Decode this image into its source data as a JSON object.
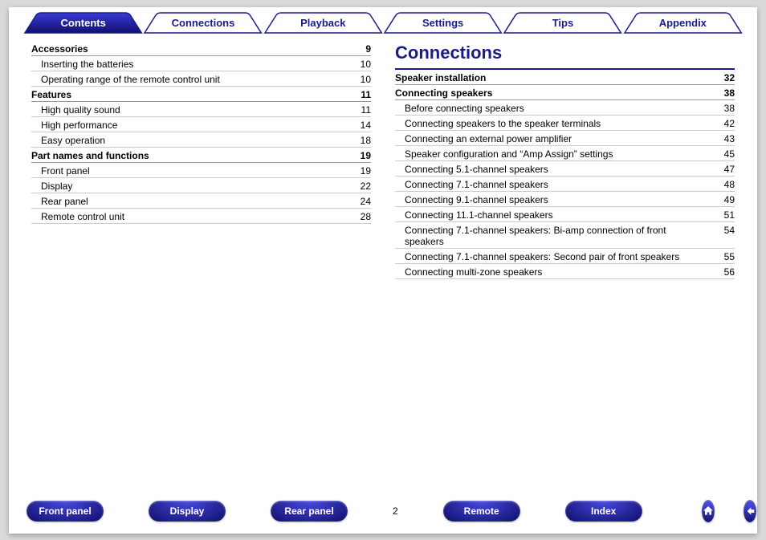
{
  "tabs": [
    {
      "label": "Contents",
      "active": true
    },
    {
      "label": "Connections",
      "active": false
    },
    {
      "label": "Playback",
      "active": false
    },
    {
      "label": "Settings",
      "active": false
    },
    {
      "label": "Tips",
      "active": false
    },
    {
      "label": "Appendix",
      "active": false
    }
  ],
  "left_col": [
    {
      "type": "hdr",
      "label": "Accessories",
      "page": "9"
    },
    {
      "type": "item",
      "label": "Inserting the batteries",
      "page": "10"
    },
    {
      "type": "item",
      "label": "Operating range of the remote control unit",
      "page": "10"
    },
    {
      "type": "hdr",
      "label": "Features",
      "page": "11"
    },
    {
      "type": "item",
      "label": "High quality sound",
      "page": "11"
    },
    {
      "type": "item",
      "label": "High performance",
      "page": "14"
    },
    {
      "type": "item",
      "label": "Easy operation",
      "page": "18"
    },
    {
      "type": "hdr",
      "label": "Part names and functions",
      "page": "19"
    },
    {
      "type": "item",
      "label": "Front panel",
      "page": "19"
    },
    {
      "type": "item",
      "label": "Display",
      "page": "22"
    },
    {
      "type": "item",
      "label": "Rear panel",
      "page": "24"
    },
    {
      "type": "item",
      "label": "Remote control unit",
      "page": "28"
    }
  ],
  "right_title": "Connections",
  "right_col": [
    {
      "type": "hdr",
      "label": "Speaker installation",
      "page": "32",
      "bluetop": true
    },
    {
      "type": "hdr",
      "label": "Connecting speakers",
      "page": "38"
    },
    {
      "type": "item",
      "label": "Before connecting speakers",
      "page": "38"
    },
    {
      "type": "item",
      "label": "Connecting speakers to the speaker terminals",
      "page": "42"
    },
    {
      "type": "item",
      "label": "Connecting an external power amplifier",
      "page": "43"
    },
    {
      "type": "item",
      "label": "Speaker configuration and “Amp Assign” settings",
      "page": "45"
    },
    {
      "type": "item",
      "label": "Connecting 5.1-channel speakers",
      "page": "47"
    },
    {
      "type": "item",
      "label": "Connecting 7.1-channel speakers",
      "page": "48"
    },
    {
      "type": "item",
      "label": "Connecting 9.1-channel speakers",
      "page": "49"
    },
    {
      "type": "item",
      "label": "Connecting 11.1-channel speakers",
      "page": "51"
    },
    {
      "type": "item",
      "label": "Connecting 7.1-channel speakers: Bi-amp connection of front speakers",
      "page": "54"
    },
    {
      "type": "item",
      "label": "Connecting 7.1-channel speakers: Second pair of front speakers",
      "page": "55"
    },
    {
      "type": "item",
      "label": "Connecting multi-zone speakers",
      "page": "56"
    }
  ],
  "footer": {
    "buttons": [
      "Front panel",
      "Display",
      "Rear panel"
    ],
    "page_num": "2",
    "buttons2": [
      "Remote",
      "Index"
    ]
  }
}
